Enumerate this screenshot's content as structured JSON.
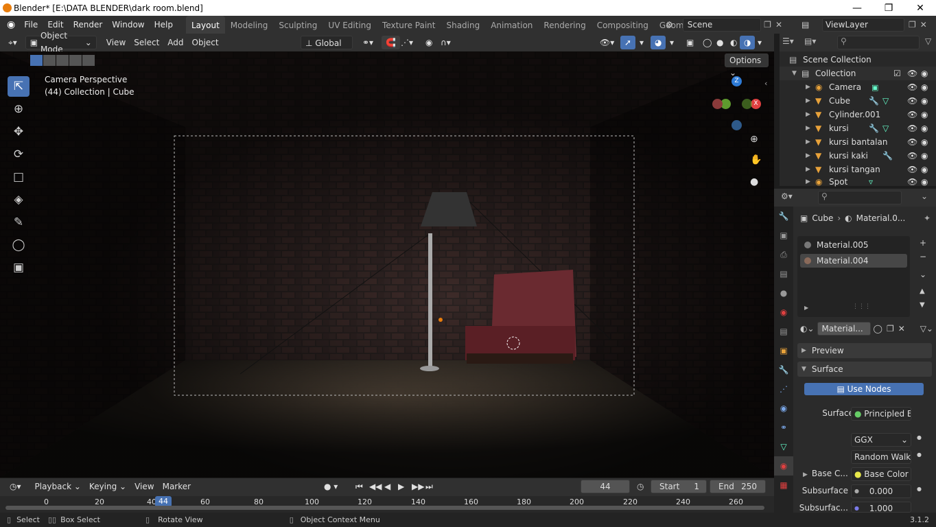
{
  "window": {
    "title": "Blender* [E:\\DATA BLENDER\\dark room.blend]"
  },
  "menu": {
    "items": [
      "File",
      "Edit",
      "Render",
      "Window",
      "Help"
    ]
  },
  "workspaces": [
    "Layout",
    "Modeling",
    "Sculpting",
    "UV Editing",
    "Texture Paint",
    "Shading",
    "Animation",
    "Rendering",
    "Compositing",
    "Geometry Nod"
  ],
  "scene": {
    "name": "Scene",
    "view_layer": "ViewLayer"
  },
  "viewport_header": {
    "mode": "Object Mode",
    "menus": [
      "View",
      "Select",
      "Add",
      "Object"
    ],
    "transform": "Global"
  },
  "viewport": {
    "options_label": "Options",
    "camera_label": "Camera Perspective",
    "info_label": "(44) Collection | Cube",
    "gizmo": {
      "z": "Z",
      "x": "X"
    }
  },
  "outliner": {
    "root": "Scene Collection",
    "collection": "Collection",
    "objects": [
      "Camera",
      "Cube",
      "Cylinder.001",
      "kursi",
      "kursi bantalan",
      "kursi kaki",
      "kursi tangan",
      "Spot"
    ]
  },
  "properties": {
    "breadcrumb": {
      "object": "Cube",
      "material": "Material.0..."
    },
    "slots": [
      "Material.005",
      "Material.004"
    ],
    "material_name": "Material...",
    "panels": {
      "preview": "Preview",
      "surface": "Surface"
    },
    "use_nodes": "Use Nodes",
    "surface_label": "Surface",
    "surface_value": "Principled B...",
    "distribution": "GGX",
    "subsurface_method": "Random Walk",
    "base_color_label": "Base C...",
    "base_color_value": "Base Color",
    "subsurface_label": "Subsurface",
    "subsurface_value": "0.000",
    "subsurface2_label": "Subsurfac...",
    "subsurface2_value": "1.000"
  },
  "timeline": {
    "menus": [
      "Playback",
      "Keying",
      "View",
      "Marker"
    ],
    "current_frame": "44",
    "start_label": "Start",
    "start_value": "1",
    "end_label": "End",
    "end_value": "250",
    "ticks": [
      "0",
      "20",
      "40",
      "60",
      "80",
      "100",
      "120",
      "140",
      "160",
      "180",
      "200",
      "220",
      "240",
      "260"
    ]
  },
  "statusbar": {
    "select": "Select",
    "box_select": "Box Select",
    "rotate": "Rotate View",
    "context": "Object Context Menu",
    "version": "3.1.2"
  },
  "colors": {
    "accent": "#4772b3",
    "header": "#303030",
    "panel": "#2b2b2b",
    "material_dot": "#e8e84a"
  }
}
